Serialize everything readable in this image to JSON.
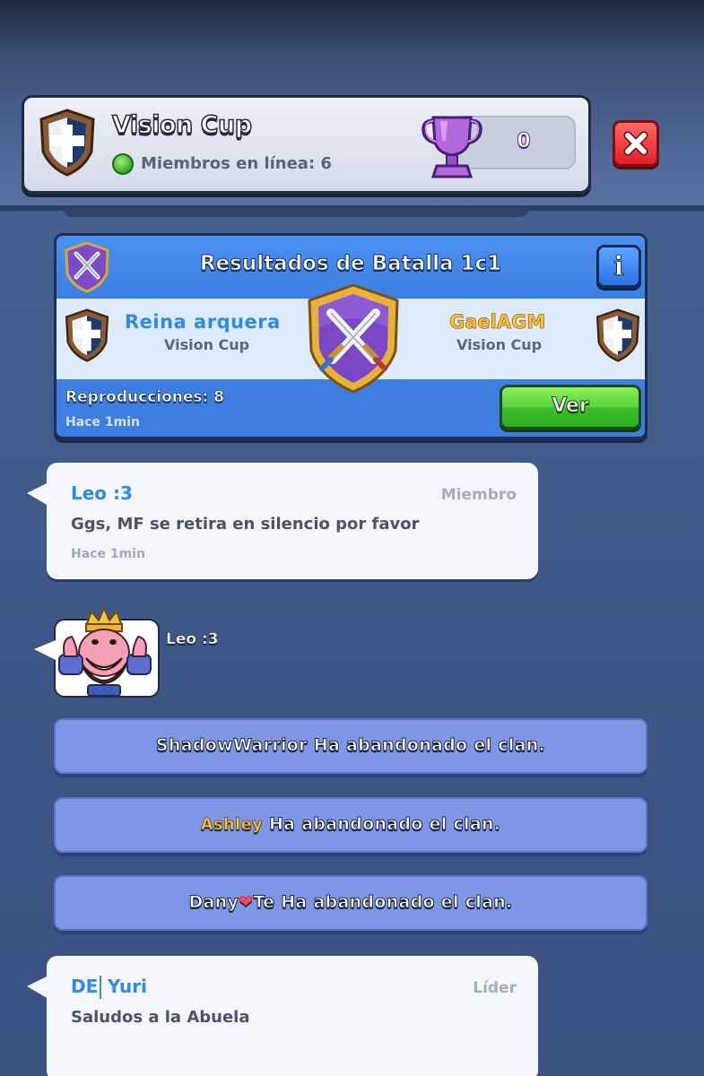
{
  "clan": {
    "name": "Vision Cup",
    "online_text": "Miembros en línea: 6",
    "trophies": "0"
  },
  "battle": {
    "title": "Resultados de Batalla 1c1",
    "info_label": "i",
    "player1": {
      "name": "Reina arquera",
      "clan": "Vision Cup"
    },
    "player2": {
      "name": "GaelAGM",
      "clan": "Vision Cup"
    },
    "replays": "Reproducciones: 8",
    "time": "Hace 1min",
    "watch_label": "Ver"
  },
  "messages": [
    {
      "author": "Leo :3",
      "role": "Miembro",
      "text": "Ggs, MF se retira en silencio por favor",
      "time": "Hace 1min"
    },
    {
      "author_tag": "DE",
      "author": "Yuri",
      "role": "Líder",
      "text": "Saludos a la Abuela"
    }
  ],
  "emote": {
    "author": "Leo :3",
    "icon": "king-thumbs-up-emote"
  },
  "system": [
    {
      "name": "ShadowWarrior",
      "suffix": " Ha abandonado el clan."
    },
    {
      "name": "Ashley",
      "suffix": " Ha abandonado el clan."
    },
    {
      "name": "Dany",
      "heart": "❤",
      "suffix": "Te Ha abandonado el clan."
    }
  ],
  "colors": {
    "accent_blue": "#2f8ae8",
    "battle_blue": "#3f86e8",
    "system_purple": "#7f95e6",
    "watch_green": "#58d33a",
    "close_red": "#e41e26"
  }
}
